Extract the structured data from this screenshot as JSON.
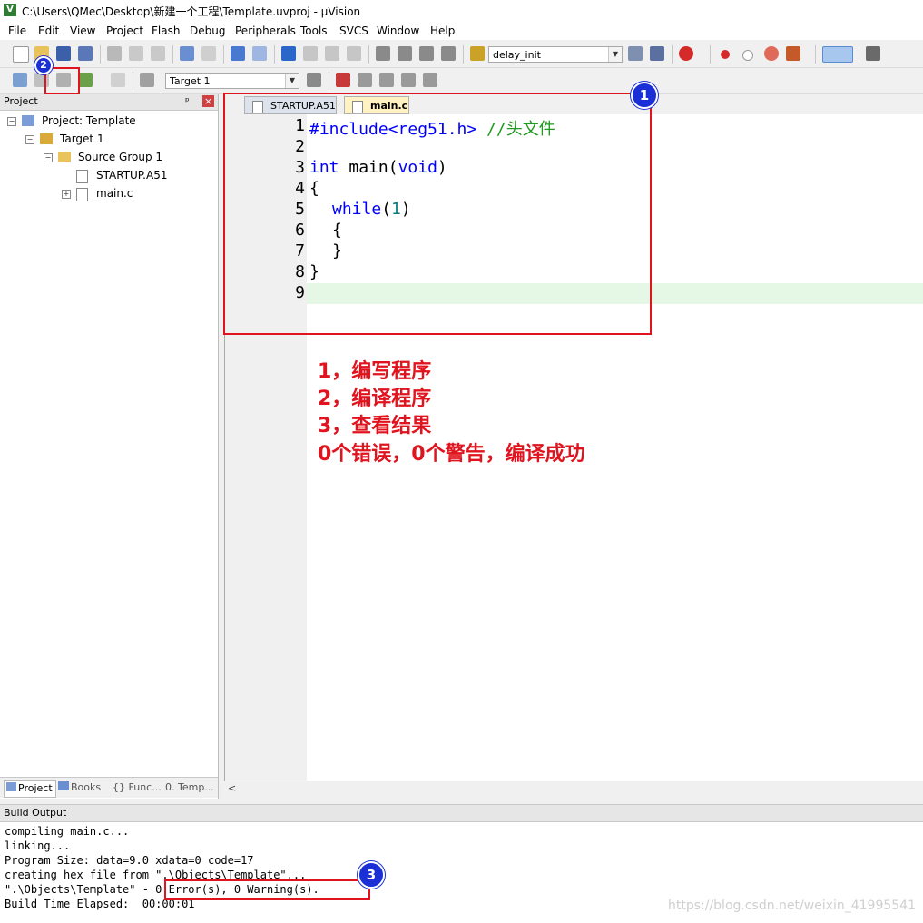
{
  "window": {
    "title": "C:\\Users\\QMec\\Desktop\\新建一个工程\\Template.uvproj - µVision"
  },
  "menu": [
    "File",
    "Edit",
    "View",
    "Project",
    "Flash",
    "Debug",
    "Peripherals",
    "Tools",
    "SVCS",
    "Window",
    "Help"
  ],
  "toolbar": {
    "function_combo": "delay_init",
    "target_combo": "Target 1"
  },
  "project_pane": {
    "header": "Project",
    "pin": "ᵖ",
    "close": "×",
    "tree": {
      "project": "Project: Template",
      "target": "Target 1",
      "group": "Source Group 1",
      "file1": "STARTUP.A51",
      "file2": "main.c"
    },
    "tabs": [
      "Project",
      "Books",
      "{} Func...",
      "0. Temp..."
    ]
  },
  "editor": {
    "tabs": [
      "STARTUP.A51",
      "main.c"
    ],
    "line_numbers": [
      "1",
      "2",
      "3",
      "4",
      "5",
      "6",
      "7",
      "8",
      "9"
    ],
    "code": {
      "l1_directive": "#include<reg51.h>",
      "l1_comment": "//头文件",
      "l3_kw1": "int",
      "l3_name": "main",
      "l3_paren_open": "(",
      "l3_kw2": "void",
      "l3_paren_close": ")",
      "l4": "{",
      "l5_kw": "while",
      "l5_open": "(",
      "l5_num": "1",
      "l5_close": ")",
      "l6": "{",
      "l7": "}",
      "l8": "}"
    }
  },
  "annotations": {
    "badge1": "1",
    "badge2": "2",
    "badge3": "3",
    "text": [
      "1，编写程序",
      "2，编译程序",
      "3，查看结果",
      "0个错误，0个警告，编译成功"
    ]
  },
  "build_output": {
    "header": "Build Output",
    "lines": [
      "compiling main.c...",
      "linking...",
      "Program Size: data=9.0 xdata=0 code=17",
      "creating hex file from \".\\Objects\\Template\"...",
      "\".\\Objects\\Template\" - 0 Error(s), 0 Warning(s).",
      "Build Time Elapsed:  00:00:01"
    ]
  },
  "watermark": "https://blog.csdn.net/weixin_41995541",
  "colors": {
    "annotation_red": "#e0141e",
    "badge_blue": "#1b2fd6",
    "keyword_blue": "#0000ff",
    "comment_green": "#1e9a1e",
    "active_line": "#e5f8e5"
  }
}
